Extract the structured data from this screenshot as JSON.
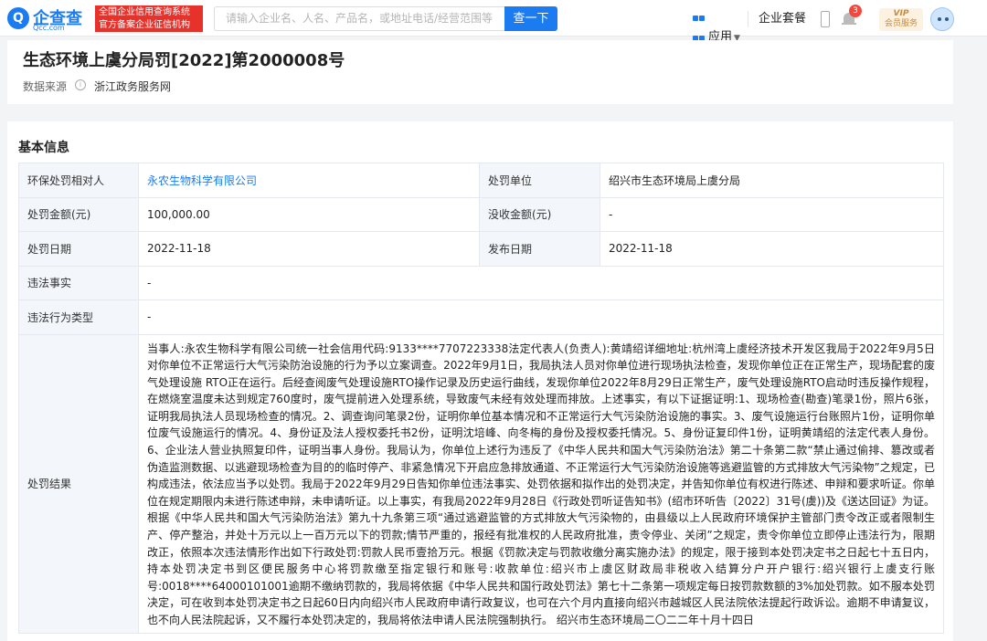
{
  "header": {
    "logo_mark": "Q",
    "logo_name": "企查查",
    "logo_domain": "Qcc.com",
    "tagline_line1": "全国企业信用查询系统",
    "tagline_line2": "官方备案企业征信机构",
    "search_placeholder": "请输入企业名、人名、产品名，或地址电话/经营范围等",
    "search_button": "查一下",
    "apps_label": "应用",
    "plans_label": "企业套餐",
    "notification_count": "3",
    "vip_line1": "VIP",
    "vip_line2": "会员服务"
  },
  "page": {
    "title": "生态环境上虞分局罚[2022]第2000008号",
    "source_label": "数据来源",
    "source_value": "浙江政务服务网"
  },
  "basic": {
    "section_title": "基本信息",
    "party_label": "环保处罚相对人",
    "party_value": "永农生物科学有限公司",
    "authority_label": "处罚单位",
    "authority_value": "绍兴市生态环境局上虞分局",
    "amount_label": "处罚金额(元)",
    "amount_value": "100,000.00",
    "confiscation_label": "没收金额(元)",
    "confiscation_value": "-",
    "date_label": "处罚日期",
    "date_value": "2022-11-18",
    "publish_label": "发布日期",
    "publish_value": "2022-11-18",
    "facts_label": "违法事实",
    "facts_value": "-",
    "type_label": "违法行为类型",
    "type_value": "-",
    "result_label": "处罚结果",
    "result_value": "当事人:永农生物科学有限公司统一社会信用代码:9133****7707223338法定代表人(负责人):黄靖绍详细地址:杭州湾上虞经济技术开发区我局于2022年9月5日对你单位不正常运行大气污染防治设施的行为予以立案调查。2022年9月1日，我局执法人员对你单位进行现场执法检查，发现你单位正在正常生产，现场配套的废气处理设施 RTO正在运行。后经查阅废气处理设施RTO操作记录及历史运行曲线，发现你单位2022年8月29日正常生产，废气处理设施RTO启动时违反操作规程，在燃烧室温度未达到规定760度时，废气提前进入处理系统，导致废气未经有效处理而排放。上述事实，有以下证据证明:1、现场检查(勘查)笔录1份，照片6张，证明我局执法人员现场检查的情况。2、调查询问笔录2份，证明你单位基本情况和不正常运行大气污染防治设施的事实。3、废气设施运行台账照片1份，证明你单位废气设施运行的情况。4、身份证及法人授权委托书2份，证明沈培峰、向冬梅的身份及授权委托情况。5、身份证复印件1份，证明黄靖绍的法定代表人身份。6、企业法人营业执照复印件，证明当事人身份。我局认为，你单位上述行为违反了《中华人民共和国大气污染防治法》第二十条第二款“禁止通过偷排、篡改或者伪造监测数据、以逃避现场检查为目的的临时停产、非紧急情况下开启应急排放通道、不正常运行大气污染防治设施等逃避监管的方式排放大气污染物”之规定，已构成违法，依法应当予以处罚。我局于2022年9月29日告知你单位违法事实、处罚依据和拟作出的处罚决定，并告知你单位有权进行陈述、申辩和要求听证。你单位在规定期限内未进行陈述申辩，未申请听证。以上事实，有我局2022年9月28日《行政处罚听证告知书》(绍市环听告〔2022〕31号(虞))及《送达回证》为证。根据《中华人民共和国大气污染防治法》第九十九条第三项“通过逃避监管的方式排放大气污染物的，由县级以上人民政府环境保护主管部门责令改正或者限制生产、停产整治，并处十万元以上一百万元以下的罚款;情节严重的，报经有批准权的人民政府批准，责令停业、关闭”之规定，责令你单位立即停止违法行为，限期改正，依照本次违法情形作出如下行政处罚:罚款人民币壹拾万元。根据《罚款决定与罚款收缴分离实施办法》的规定，限于接到本处罚决定书之日起七十五日内，持本处罚决定书到区便民服务中心将罚款缴至指定银行和账号:收款单位:绍兴市上虞区财政局非税收入结算分户开户银行:绍兴银行上虞支行账号:0018****64000101001逾期不缴纳罚款的，我局将依据《中华人民共和国行政处罚法》第七十二条第一项规定每日按罚款数额的3%加处罚款。如不服本处罚决定，可在收到本处罚决定书之日起60日内向绍兴市人民政府申请行政复议，也可在六个月内直接向绍兴市越城区人民法院依法提起行政诉讼。逾期不申请复议，也不向人民法院起诉，又不履行本处罚决定的，我局将依法申请人民法院强制执行。 绍兴市生态环境局二〇二二年十月十四日"
  },
  "colors": {
    "brand": "#1a7cf0",
    "tagline_bg": "#e6322b",
    "label_bg": "#f3f6fb",
    "vip_gold": "#c88b3b"
  },
  "icons": [
    "logo-icon",
    "apps-grid-icon",
    "phone-icon",
    "bell-icon",
    "info-icon",
    "avatar-icon"
  ]
}
